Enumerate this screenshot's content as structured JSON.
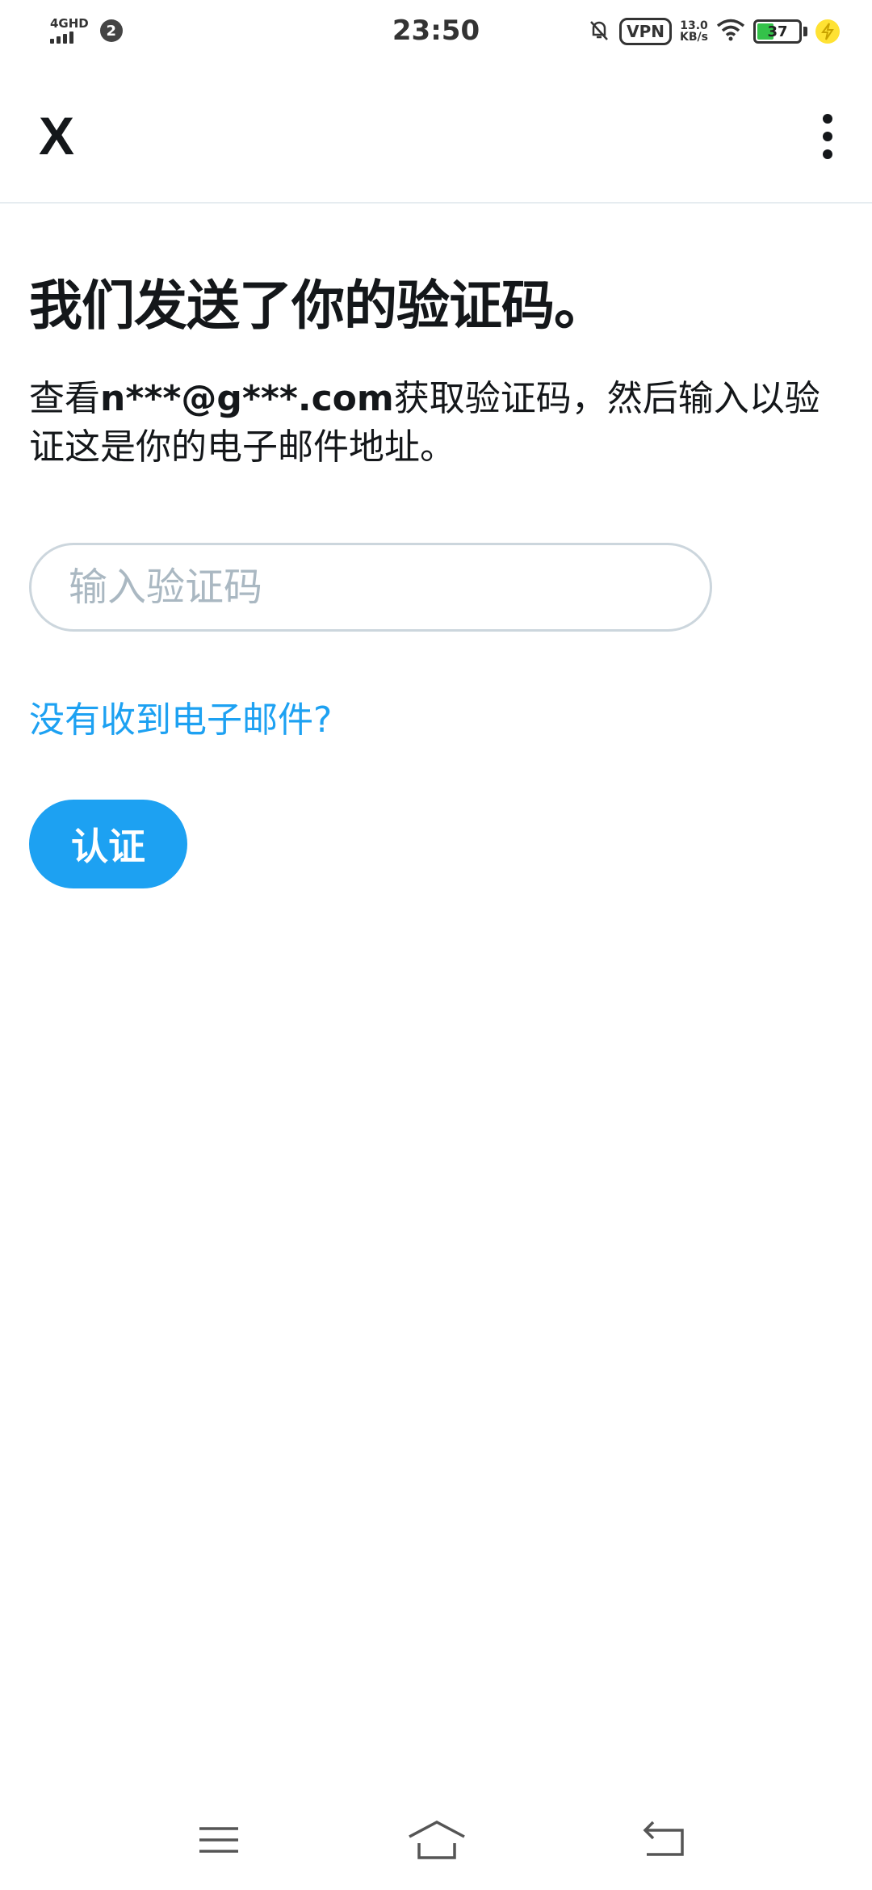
{
  "status_bar": {
    "network_type": "4GHD",
    "sim_badge": "2",
    "time": "23:50",
    "vpn_label": "VPN",
    "speed_value": "13.0",
    "speed_unit": "KB/s",
    "battery_level": "37",
    "battery_fraction": 0.37
  },
  "top_bar": {
    "logo": "X"
  },
  "main": {
    "heading": "我们发送了你的验证码。",
    "desc_prefix": "查看",
    "desc_email": "n***@g***.com",
    "desc_suffix": "获取验证码，然后输入以验证这是你的电子邮件地址。",
    "code_placeholder": "输入验证码",
    "resend_link": "没有收到电子邮件?",
    "verify_button": "认证"
  },
  "colors": {
    "accent": "#1da1f2",
    "text": "#14171a",
    "placeholder": "#aab8c2",
    "border": "#ccd6dd"
  }
}
